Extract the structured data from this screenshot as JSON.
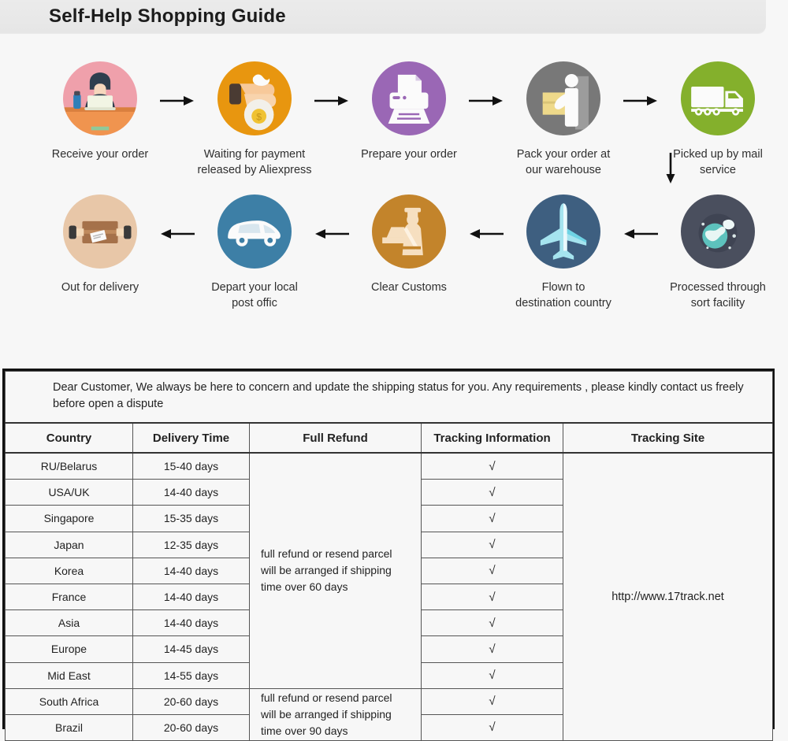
{
  "header": {
    "title": "Self-Help Shopping Guide"
  },
  "flow": {
    "down_arrow_icon": "arrow-down-icon",
    "row1": [
      {
        "label": "Receive your order",
        "icon": "person-at-laptop-icon",
        "bg": "#efa0ab"
      },
      {
        "label": "Waiting for payment\nreleased by Aliexpress",
        "icon": "hand-with-money-bag-icon",
        "bg": "#e8960f"
      },
      {
        "label": "Prepare your order",
        "icon": "printer-icon",
        "bg": "#9a67b5"
      },
      {
        "label": "Pack your order at\nour warehouse",
        "icon": "worker-with-box-icon",
        "bg": "#787878"
      },
      {
        "label": "Picked up by mail service",
        "icon": "delivery-truck-icon",
        "bg": "#84b02c"
      }
    ],
    "row2": [
      {
        "label": "Out for delivery",
        "icon": "parcel-box-icon",
        "bg": "#e8c7a8"
      },
      {
        "label": "Depart your local\npost offic",
        "icon": "delivery-van-icon",
        "bg": "#3d7fa6"
      },
      {
        "label": "Clear  Customs",
        "icon": "customs-officer-icon",
        "bg": "#c3842b"
      },
      {
        "label": "Flown to\ndestination country",
        "icon": "airplane-icon",
        "bg": "#3e5f80"
      },
      {
        "label": "Processed through\nsort facility",
        "icon": "sorting-facility-globe-icon",
        "bg": "#4a4f5e"
      }
    ],
    "arrow_right_icon": "arrow-right-icon",
    "arrow_left_icon": "arrow-left-icon"
  },
  "table": {
    "notice": "Dear Customer, We always be here to concern and update the shipping status for you.  Any requirements , please kindly contact us freely before open a dispute",
    "columns": [
      "Country",
      "Delivery Time",
      "Full Refund",
      "Tracking Information",
      "Tracking Site"
    ],
    "refund_group_1": "full refund or resend parcel\nwill be arranged if shipping\ntime over 60 days",
    "refund_group_2": "full refund or resend parcel\nwill be arranged if shipping\ntime over 90 days",
    "tracking_site": "http://www.17track.net",
    "tick": "√",
    "rows": [
      {
        "country": "RU/Belarus",
        "time": "15-40 days"
      },
      {
        "country": "USA/UK",
        "time": "14-40 days"
      },
      {
        "country": "Singapore",
        "time": "15-35 days"
      },
      {
        "country": "Japan",
        "time": "12-35 days"
      },
      {
        "country": "Korea",
        "time": "14-40 days"
      },
      {
        "country": "France",
        "time": "14-40 days"
      },
      {
        "country": "Asia",
        "time": "14-40 days"
      },
      {
        "country": "Europe",
        "time": "14-45 days"
      },
      {
        "country": "Mid East",
        "time": "14-55 days"
      },
      {
        "country": "South Africa",
        "time": "20-60 days"
      },
      {
        "country": "Brazil",
        "time": "20-60 days"
      }
    ]
  }
}
